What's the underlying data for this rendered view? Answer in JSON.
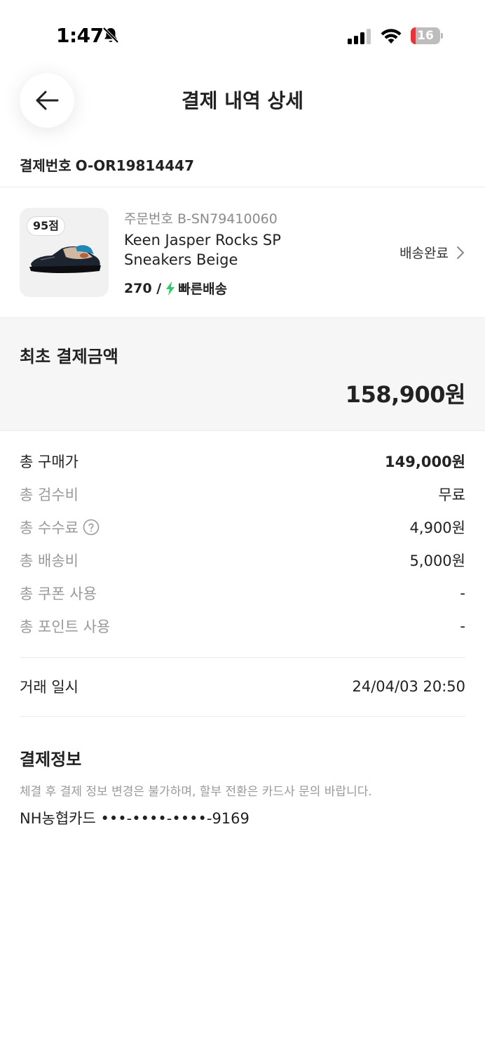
{
  "status_bar": {
    "time": "1:47",
    "battery_level": "16",
    "battery_fraction": 0.16
  },
  "header": {
    "title": "결제 내역 상세"
  },
  "payment": {
    "number_label": "결제번호",
    "number": "O-OR19814447"
  },
  "product": {
    "score_badge": "95점",
    "order_number": "주문번호 B-SN79410060",
    "name_line1": "Keen Jasper Rocks SP",
    "name_line2": "Sneakers Beige",
    "size": "270 /",
    "shipping": "빠른배송",
    "status": "배송완료"
  },
  "amount": {
    "label": "최초 결제금액",
    "value": "158,900원"
  },
  "breakdown": [
    {
      "label": "총 구매가",
      "value": "149,000원"
    },
    {
      "label": "총 검수비",
      "value": "무료"
    },
    {
      "label": "총 수수료",
      "value": "4,900원"
    },
    {
      "label": "총 배송비",
      "value": "5,000원"
    },
    {
      "label": "총 쿠폰 사용",
      "value": "-"
    },
    {
      "label": "총 포인트 사용",
      "value": "-"
    }
  ],
  "transaction": {
    "label": "거래 일시",
    "value": "24/04/03 20:50"
  },
  "payment_info": {
    "title": "결제정보",
    "note": "체결 후 결제 정보 변경은 불가하며, 할부 전환은 카드사 문의 바랍니다.",
    "card": "NH농협카드 •••-••••-••••-9169"
  },
  "colors": {
    "accent_green": "#31c76b",
    "battery_red": "#e5353b"
  }
}
